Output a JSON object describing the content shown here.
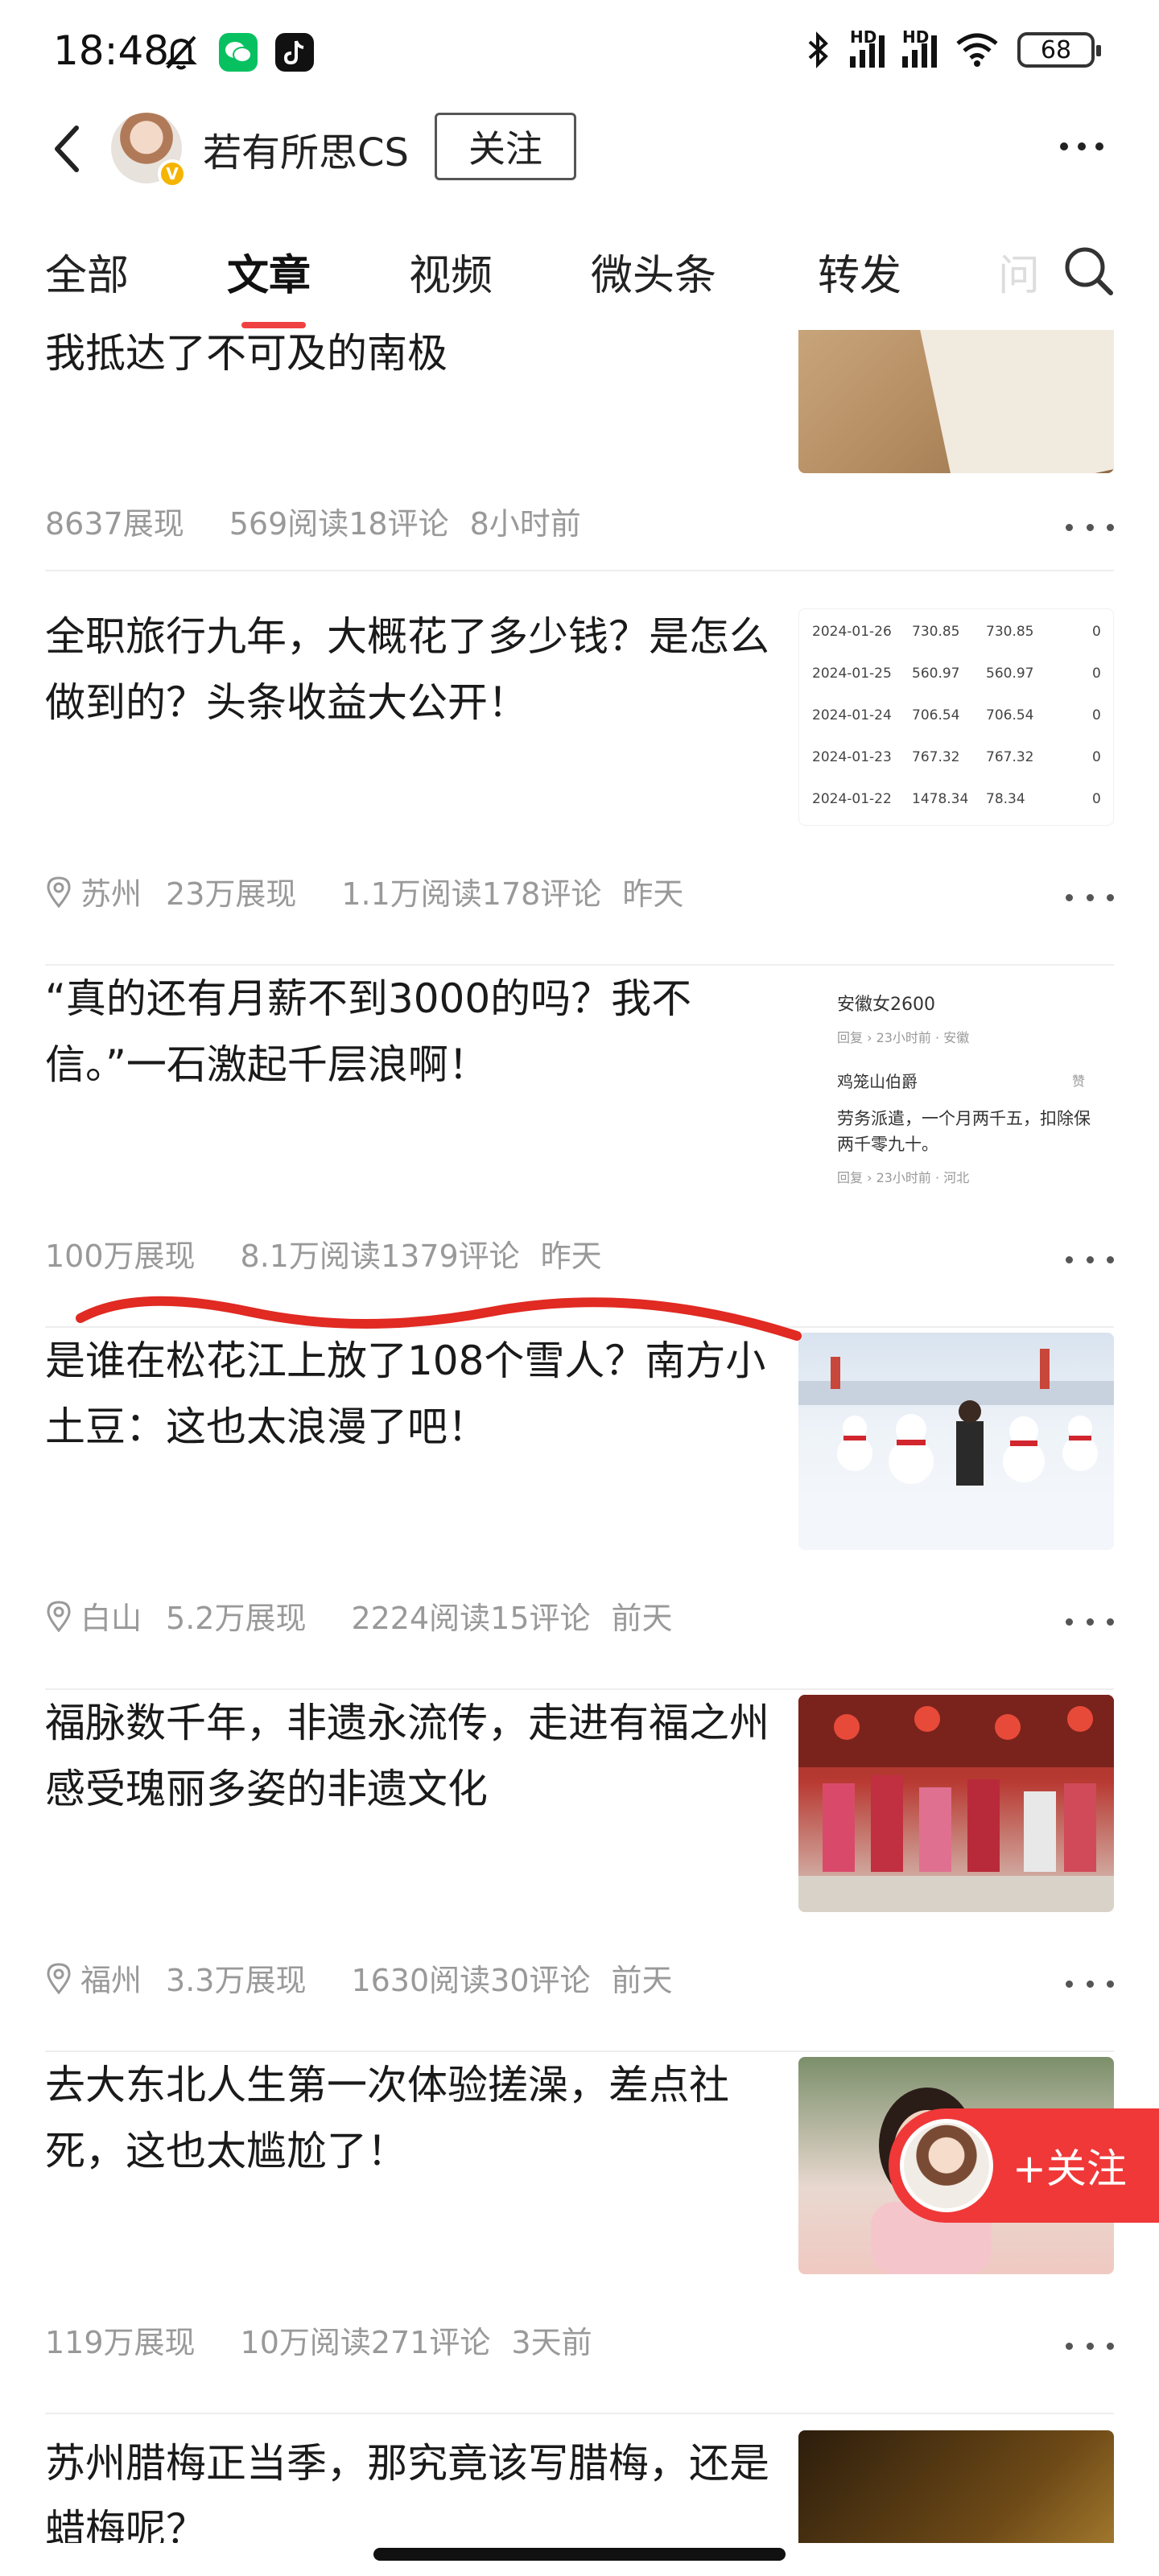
{
  "status_bar": {
    "time": "18:48",
    "battery": "68",
    "hd1": "HD",
    "hd2": "HD"
  },
  "header": {
    "author_name": "若有所思CS",
    "follow_label": "关注",
    "verify_mark": "V"
  },
  "tabs": [
    {
      "label": "全部"
    },
    {
      "label": "文章"
    },
    {
      "label": "视频"
    },
    {
      "label": "微头条"
    },
    {
      "label": "转发"
    }
  ],
  "tab_faded": "问",
  "accent_color": "#f04142",
  "articles": [
    {
      "title": "我抵达了不可及的南极",
      "impressions": "8637展现",
      "reads": "569阅读18评论",
      "time": "8小时前"
    },
    {
      "title": "全职旅行九年，大概花了多少钱？是怎么做到的？头条收益大公开！",
      "location": "苏州",
      "impressions": "23万展现",
      "reads": "1.1万阅读178评论",
      "time": "昨天",
      "table_rows": [
        [
          "2024-01-26",
          "730.85",
          "730.85",
          "0"
        ],
        [
          "2024-01-25",
          "560.97",
          "560.97",
          "0"
        ],
        [
          "2024-01-24",
          "706.54",
          "706.54",
          "0"
        ],
        [
          "2024-01-23",
          "767.32",
          "767.32",
          "0"
        ],
        [
          "2024-01-22",
          "1478.34",
          "78.34",
          "0"
        ]
      ]
    },
    {
      "title": "“真的还有月薪不到3000的吗？我不信。”一石激起千层浪啊！",
      "impressions": "100万展现",
      "reads": "8.1万阅读1379评论",
      "time": "昨天",
      "comment_lines": {
        "c1": "安徽女2600",
        "c1_sub": "回复 › 23小时前 · 安徽",
        "c2_user": "鸡笼山伯爵",
        "c2_like": "赞",
        "c2_text": "劳务派遣，一个月两千五，扣除保",
        "c2_text2": "两千零九十。",
        "c2_sub": "回复 › 23小时前 · 河北"
      }
    },
    {
      "title": "是谁在松花江上放了108个雪人？南方小土豆：这也太浪漫了吧！",
      "location": "白山",
      "impressions": "5.2万展现",
      "reads": "2224阅读15评论",
      "time": "前天"
    },
    {
      "title": "福脉数千年，非遗永流传，走进有福之州感受瑰丽多姿的非遗文化",
      "location": "福州",
      "impressions": "3.3万展现",
      "reads": "1630阅读30评论",
      "time": "前天"
    },
    {
      "title": "去大东北人生第一次体验搓澡，差点社死，这也太尴尬了！",
      "impressions": "119万展现",
      "reads": "10万阅读271评论",
      "time": "3天前"
    },
    {
      "title": "苏州腊梅正当季，那究竟该写腊梅，还是蜡梅呢？"
    }
  ],
  "float_follow_label": "+关注",
  "icons": {
    "back": "chevron-left-icon",
    "more": "more-dots-icon",
    "search": "search-icon",
    "location": "location-pin-icon",
    "mute": "bell-mute-icon",
    "bluetooth": "bluetooth-icon",
    "wifi": "wifi-icon"
  }
}
